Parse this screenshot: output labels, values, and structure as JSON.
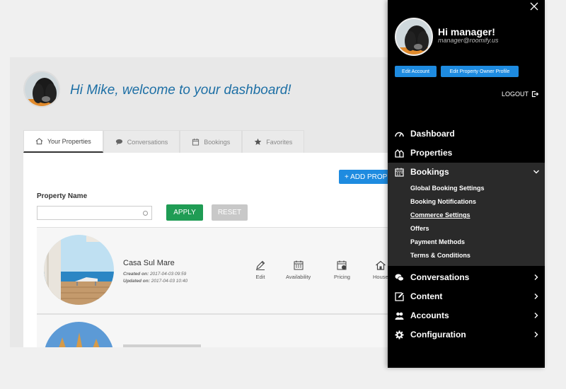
{
  "dashboard": {
    "welcome": "Hi Mike, welcome to your dashboard!",
    "tabs": [
      {
        "label": "Your Properties",
        "icon": "house-icon",
        "active": true
      },
      {
        "label": "Conversations",
        "icon": "chat-icon",
        "active": false
      },
      {
        "label": "Bookings",
        "icon": "calendar-icon",
        "active": false
      },
      {
        "label": "Favorites",
        "icon": "star-icon",
        "active": false
      }
    ],
    "add_property": "+ ADD PROPERTY",
    "filter": {
      "label": "Property Name",
      "value": "",
      "apply": "APPLY",
      "reset": "RESET"
    },
    "properties": [
      {
        "name": "Casa Sul Mare",
        "created_label": "Created on:",
        "created": "2017-04-03 09:59",
        "updated_label": "Updated on:",
        "updated": "2017-04-03 10:40",
        "actions": [
          "Edit",
          "Availability",
          "Pricing",
          "House"
        ]
      }
    ]
  },
  "drawer": {
    "greeting": "Hi manager!",
    "email": "manager@roomify.us",
    "edit_account": "Edit Account",
    "edit_owner_profile": "Edit Property Owner Profile",
    "logout": "LOGOUT",
    "nav": [
      {
        "label": "Dashboard",
        "icon": "dashboard-icon"
      },
      {
        "label": "Properties",
        "icon": "properties-icon"
      },
      {
        "label": "Bookings",
        "icon": "calendar-icon",
        "expanded": true,
        "children": [
          "Global Booking Settings",
          "Booking Notifications",
          "Commerce Settings",
          "Offers",
          "Payment Methods",
          "Terms & Conditions"
        ]
      },
      {
        "label": "Conversations",
        "icon": "chat-icon"
      },
      {
        "label": "Content",
        "icon": "edit-icon"
      },
      {
        "label": "Accounts",
        "icon": "users-icon"
      },
      {
        "label": "Configuration",
        "icon": "gear-icon"
      }
    ]
  },
  "colors": {
    "accent": "#1e8be0",
    "apply": "#1f9c54",
    "welcome": "#1d6fa5",
    "drawer_bg": "#000000",
    "submenu_bg": "#2a2a2a"
  }
}
